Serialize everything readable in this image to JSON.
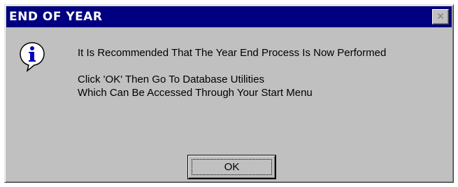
{
  "dialog": {
    "title": "END OF YEAR",
    "close_glyph": "✕",
    "icon": "info-icon",
    "message_line1": "It Is Recommended That The Year End Process Is Now Performed",
    "message_line2": "Click 'OK' Then Go To Database Utilities",
    "message_line3": "Which Can Be Accessed Through Your Start Menu",
    "ok_label": "OK"
  },
  "colors": {
    "titlebar": "#000080",
    "face": "#c0c0c0",
    "icon_blue": "#0000c0"
  }
}
